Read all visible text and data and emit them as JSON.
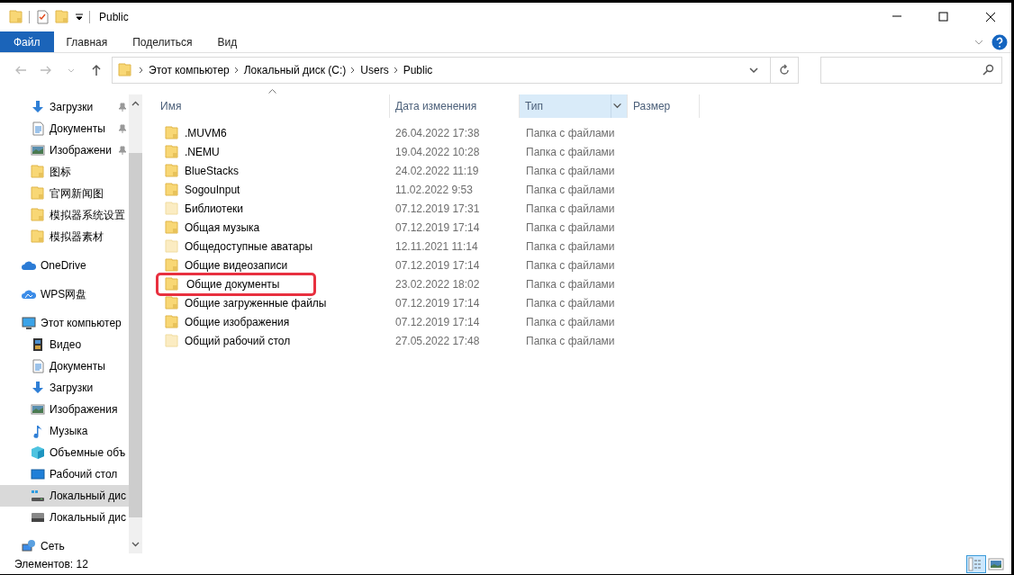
{
  "window": {
    "title": "Public"
  },
  "ribbon": {
    "tabs": [
      {
        "label": "Файл",
        "selected": true
      },
      {
        "label": "Главная",
        "selected": false
      },
      {
        "label": "Поделиться",
        "selected": false
      },
      {
        "label": "Вид",
        "selected": false
      }
    ]
  },
  "address_bar": {
    "breadcrumbs": [
      "Этот компьютер",
      "Локальный диск (C:)",
      "Users",
      "Public"
    ]
  },
  "sidebar": {
    "quick_access": [
      {
        "label": "Загрузки",
        "kind": "download",
        "pinned": true
      },
      {
        "label": "Документы",
        "kind": "document",
        "pinned": true
      },
      {
        "label": "Изображени",
        "kind": "picture",
        "pinned": true
      },
      {
        "label": "图标",
        "kind": "folder",
        "pinned": false
      },
      {
        "label": "官网新闻图",
        "kind": "folder",
        "pinned": false
      },
      {
        "label": "模拟器系统设置",
        "kind": "folder",
        "pinned": false
      },
      {
        "label": "模拟器素材",
        "kind": "folder",
        "pinned": false
      }
    ],
    "items": [
      {
        "label": "OneDrive",
        "kind": "cloud",
        "selected": false
      },
      {
        "label": "WPS网盘",
        "kind": "cloud2",
        "selected": false
      },
      {
        "label": "Этот компьютер",
        "kind": "pc",
        "selected": false,
        "children": [
          {
            "label": "Видео",
            "kind": "film",
            "selected": false
          },
          {
            "label": "Документы",
            "kind": "document",
            "selected": false
          },
          {
            "label": "Загрузки",
            "kind": "download",
            "selected": false
          },
          {
            "label": "Изображения",
            "kind": "picture",
            "selected": false
          },
          {
            "label": "Музыка",
            "kind": "music",
            "selected": false
          },
          {
            "label": "Объемные объ",
            "kind": "cube",
            "selected": false
          },
          {
            "label": "Рабочий стол",
            "kind": "desktop",
            "selected": false
          },
          {
            "label": "Локальный дис",
            "kind": "drive-win",
            "selected": true
          },
          {
            "label": "Локальный дис",
            "kind": "drive",
            "selected": false
          }
        ]
      },
      {
        "label": "Сеть",
        "kind": "network",
        "selected": false
      }
    ]
  },
  "table": {
    "columns": [
      {
        "label": "Имя",
        "sorted": true,
        "hovered": false
      },
      {
        "label": "Дата изменения",
        "sorted": false,
        "hovered": false
      },
      {
        "label": "Тип",
        "sorted": false,
        "hovered": true
      },
      {
        "label": "Размер",
        "sorted": false,
        "hovered": false
      }
    ],
    "rows": [
      {
        "name": ".MUVM6",
        "date": "26.04.2022 17:38",
        "type": "Папка с файлами",
        "hidden": false,
        "highlighted": false
      },
      {
        "name": ".NEMU",
        "date": "19.04.2022 10:28",
        "type": "Папка с файлами",
        "hidden": false,
        "highlighted": false
      },
      {
        "name": "BlueStacks",
        "date": "24.02.2022 11:19",
        "type": "Папка с файлами",
        "hidden": false,
        "highlighted": false
      },
      {
        "name": "SogouInput",
        "date": "11.02.2022 9:53",
        "type": "Папка с файлами",
        "hidden": false,
        "highlighted": false
      },
      {
        "name": "Библиотеки",
        "date": "07.12.2019 17:31",
        "type": "Папка с файлами",
        "hidden": true,
        "highlighted": false
      },
      {
        "name": "Общая музыка",
        "date": "07.12.2019 17:14",
        "type": "Папка с файлами",
        "hidden": false,
        "highlighted": false
      },
      {
        "name": "Общедоступные аватары",
        "date": "12.11.2021 11:14",
        "type": "Папка с файлами",
        "hidden": true,
        "highlighted": false
      },
      {
        "name": "Общие видеозаписи",
        "date": "07.12.2019 17:14",
        "type": "Папка с файлами",
        "hidden": false,
        "highlighted": false
      },
      {
        "name": "Общие документы",
        "date": "23.02.2022 18:02",
        "type": "Папка с файлами",
        "hidden": false,
        "highlighted": true
      },
      {
        "name": "Общие загруженные файлы",
        "date": "07.12.2019 17:14",
        "type": "Папка с файлами",
        "hidden": false,
        "highlighted": false
      },
      {
        "name": "Общие изображения",
        "date": "07.12.2019 17:14",
        "type": "Папка с файлами",
        "hidden": false,
        "highlighted": false
      },
      {
        "name": "Общий рабочий стол",
        "date": "27.05.2022 17:48",
        "type": "Папка с файлами",
        "hidden": true,
        "highlighted": false
      }
    ]
  },
  "status_bar": {
    "item_count": "Элементов: 12",
    "views": [
      {
        "kind": "details",
        "selected": true
      },
      {
        "kind": "thumbnails",
        "selected": false
      }
    ]
  }
}
